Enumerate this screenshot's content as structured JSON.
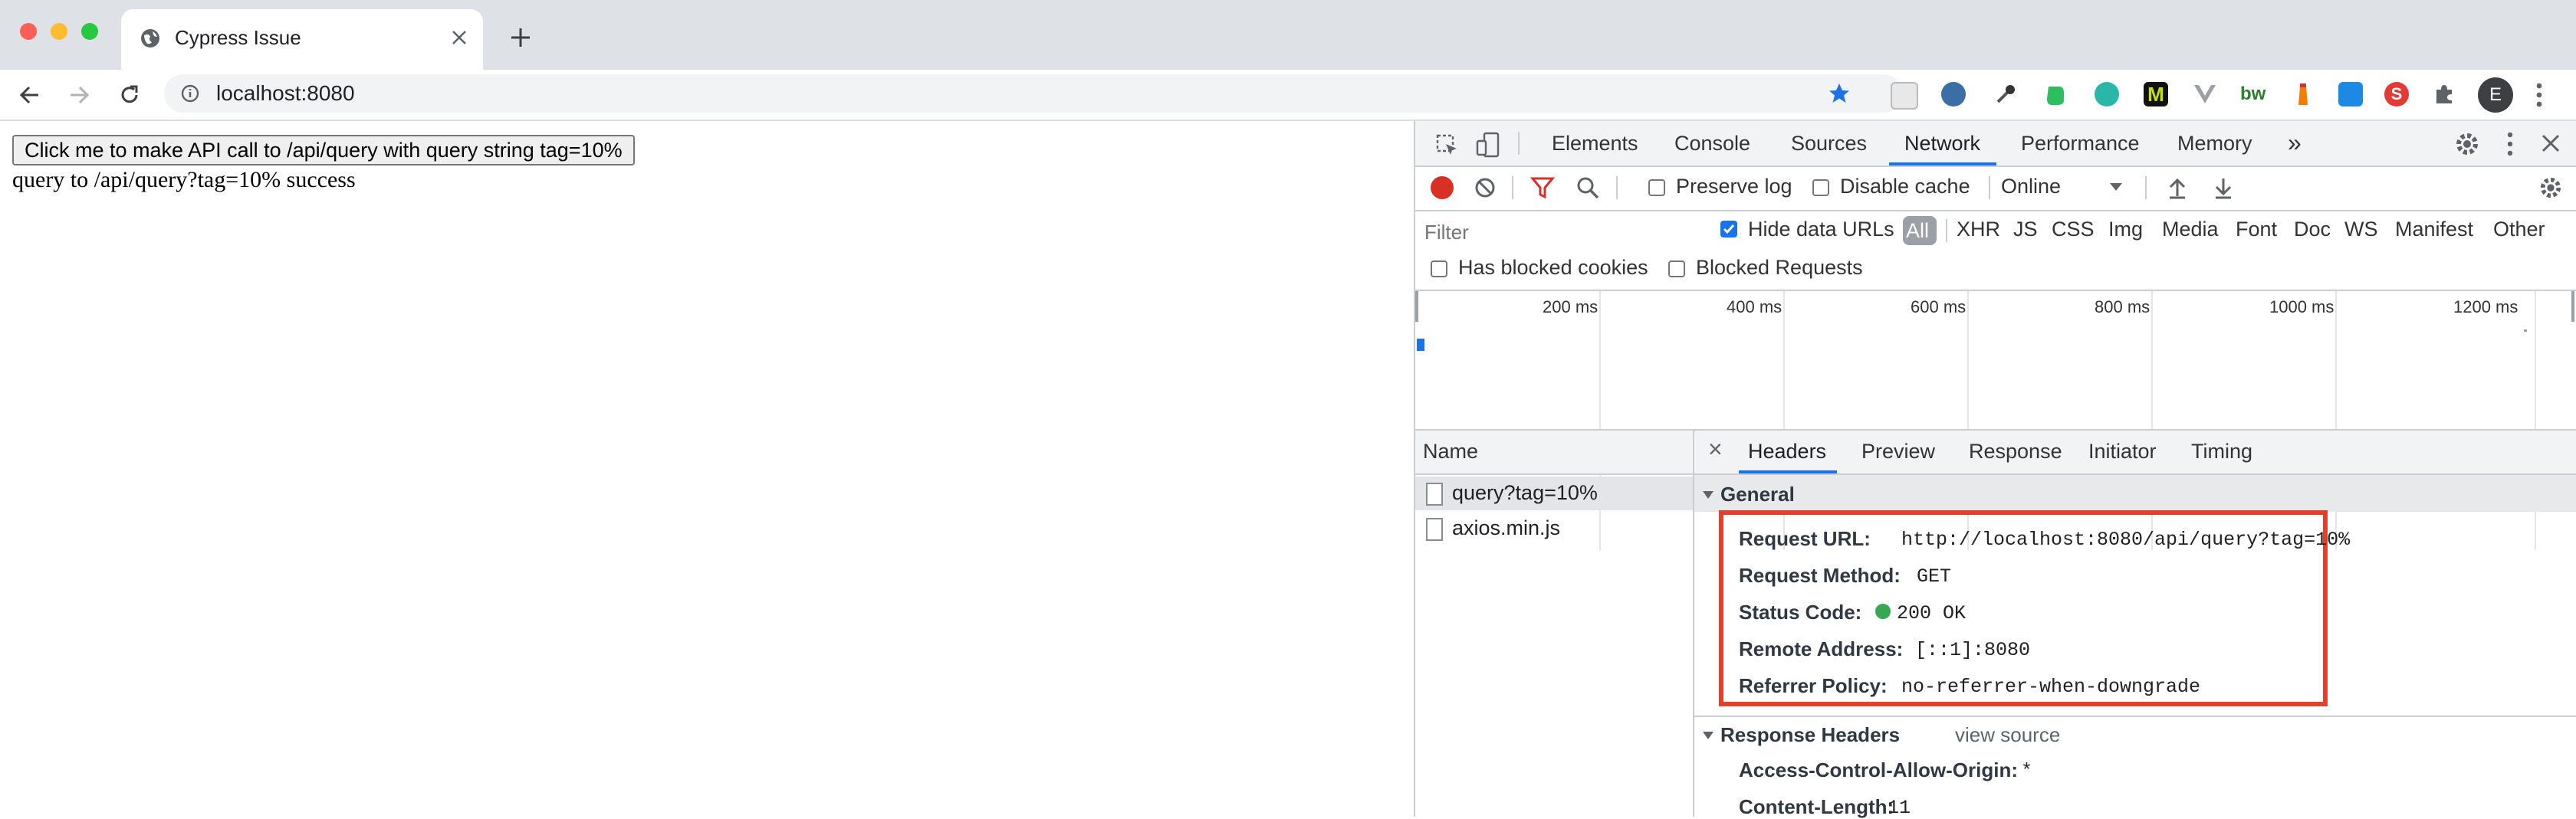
{
  "window": {
    "tab_title": "Cypress Issue",
    "url": "localhost:8080"
  },
  "page": {
    "button_label": "Click me to make API call to /api/query with query string tag=10%",
    "result_text": "query to /api/query?tag=10% success"
  },
  "devtools": {
    "panels": [
      "Elements",
      "Console",
      "Sources",
      "Network",
      "Performance",
      "Memory"
    ],
    "active_panel": "Network",
    "more": "»",
    "toolbar": {
      "preserve_log": "Preserve log",
      "disable_cache": "Disable cache",
      "throttle": "Online"
    },
    "filter": {
      "placeholder": "Filter",
      "hide_data_urls": "Hide data URLs",
      "types": [
        "All",
        "XHR",
        "JS",
        "CSS",
        "Img",
        "Media",
        "Font",
        "Doc",
        "WS",
        "Manifest",
        "Other"
      ],
      "has_blocked_cookies": "Has blocked cookies",
      "blocked_requests": "Blocked Requests"
    },
    "timeline_ticks": [
      "200 ms",
      "400 ms",
      "600 ms",
      "800 ms",
      "1000 ms",
      "1200 ms"
    ],
    "requests": {
      "header": "Name",
      "items": [
        "query?tag=10%",
        "axios.min.js"
      ]
    },
    "detail_tabs": [
      "Headers",
      "Preview",
      "Response",
      "Initiator",
      "Timing"
    ],
    "close": "×",
    "general": {
      "title": "General",
      "request_url_key": "Request URL:",
      "request_url": "http://localhost:8080/api/query?tag=10%",
      "method_key": "Request Method:",
      "method": "GET",
      "status_key": "Status Code:",
      "status": "200 OK",
      "remote_key": "Remote Address:",
      "remote": "[::1]:8080",
      "referrer_key": "Referrer Policy:",
      "referrer": "no-referrer-when-downgrade"
    },
    "response_headers": {
      "title": "Response Headers",
      "view_source": "view source",
      "acao_key": "Access-Control-Allow-Origin:",
      "acao": "*",
      "content_length_key": "Content-Length:",
      "content_length": "11"
    }
  },
  "colors": {
    "accent": "#1a73e8",
    "highlight_box": "#e0412d",
    "record": "#d93025",
    "status_ok": "#34a853"
  }
}
